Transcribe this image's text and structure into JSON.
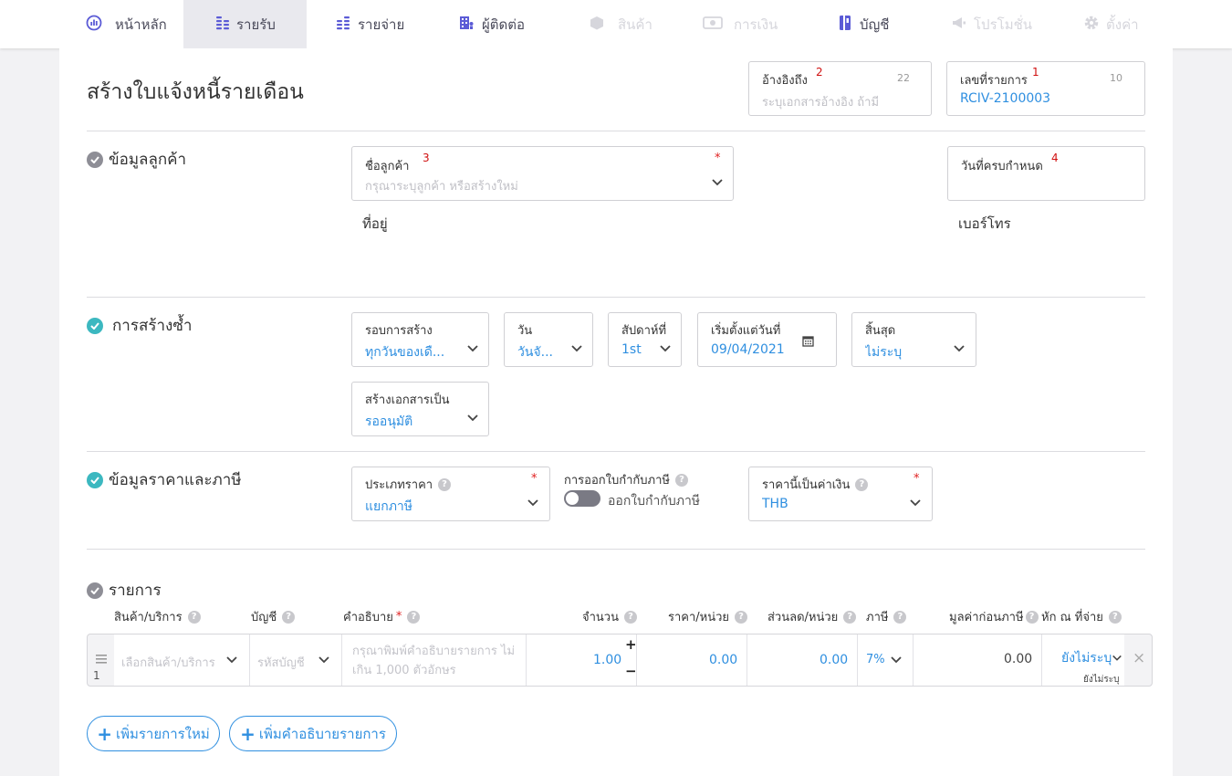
{
  "nav": {
    "items": [
      {
        "label": "หน้าหลัก",
        "icon": "dashboard-icon"
      },
      {
        "label": "รายรับ",
        "icon": "coins-icon"
      },
      {
        "label": "รายจ่าย",
        "icon": "coins-icon"
      },
      {
        "label": "ผู้ติดต่อ",
        "icon": "building-icon"
      },
      {
        "label": "สินค้า",
        "icon": "box-icon"
      },
      {
        "label": "การเงิน",
        "icon": "money-icon"
      },
      {
        "label": "บัญชี",
        "icon": "book-icon"
      },
      {
        "label": "โปรโมชั่น",
        "icon": "megaphone-icon"
      },
      {
        "label": "ตั้งค่า",
        "icon": "gear-icon"
      }
    ]
  },
  "header": {
    "title": "สร้างใบแจ้งหนี้รายเดือน",
    "reference": {
      "label": "อ้างอิงถึง",
      "badge": "2",
      "count": "22",
      "placeholder": "ระบุเอกสารอ้างอิง ถ้ามี"
    },
    "doc_no": {
      "label": "เลขที่รายการ",
      "badge": "1",
      "count": "10",
      "value": "RCIV-2100003"
    }
  },
  "customer": {
    "section_title": "ข้อมูลลูกค้า",
    "name_label": "ชื่อลูกค้า",
    "name_badge": "3",
    "name_required": "*",
    "name_placeholder": "กรุณาระบุลูกค้า หรือสร้างใหม่",
    "due_label": "วันที่ครบกำหนด",
    "due_badge": "4",
    "address_label": "ที่อยู่",
    "phone_label": "เบอร์โทร"
  },
  "recurrence": {
    "section_title": "การสร้างซ้ำ",
    "cycle": {
      "label": "รอบการสร้าง",
      "value": "ทุกวันของเดื..."
    },
    "day": {
      "label": "วัน",
      "value": "วันจั..."
    },
    "week": {
      "label": "สัปดาห์ที่",
      "value": "1st"
    },
    "start": {
      "label": "เริ่มตั้งแต่วันที่",
      "value": "09/04/2021"
    },
    "end": {
      "label": "สิ้นสุด",
      "value": "ไม่ระบุ"
    },
    "create_as": {
      "label": "สร้างเอกสารเป็น",
      "value": "รออนุมัติ"
    }
  },
  "pricing": {
    "section_title": "ข้อมูลราคาและภาษี",
    "price_type": {
      "label": "ประเภทราคา",
      "value": "แยกภาษี",
      "required": "*"
    },
    "tax_invoice": {
      "label": "การออกใบกำกับภาษี",
      "toggle_text": "ออกใบกำกับภาษี"
    },
    "currency": {
      "label": "ราคานี้เป็นค่าเงิน",
      "value": "THB",
      "required": "*"
    }
  },
  "items": {
    "section_title": "รายการ",
    "headers": {
      "product": "สินค้า/บริการ",
      "account": "บัญชี",
      "desc": "คำอธิบาย",
      "desc_required": "*",
      "qty": "จำนวน",
      "price": "ราคา/หน่วย",
      "discount": "ส่วนลด/หน่วย",
      "tax": "ภาษี",
      "pretax": "มูลค่าก่อนภาษี",
      "wht": "หัก ณ ที่จ่าย"
    },
    "row": {
      "index": "1",
      "product_ph": "เลือกสินค้า/บริการ",
      "account_ph": "รหัสบัญชี",
      "desc_ph_1": "กรุณาพิมพ์คำอธิบายรายการ ไม่",
      "desc_ph_2": "เกิน 1,000 ตัวอักษร",
      "qty": "1.00",
      "plus": "+",
      "minus": "−",
      "price": "0.00",
      "discount": "0.00",
      "tax": "7%",
      "pretax": "0.00",
      "wht": "ยังไม่ระบุ",
      "wht_sub": "ยังไม่ระบุ",
      "remove": "×"
    },
    "add_item_button": "เพิ่มรายการใหม่",
    "add_desc_button": "เพิ่มคำอธิบายรายการ"
  },
  "colors": {
    "accent": "#2f8fe0",
    "check_done": "#3cb8c0",
    "check_pending": "#8e8e96",
    "required": "#e02020",
    "badge": "#d01010",
    "nav_icon": "#5b5bd6"
  }
}
